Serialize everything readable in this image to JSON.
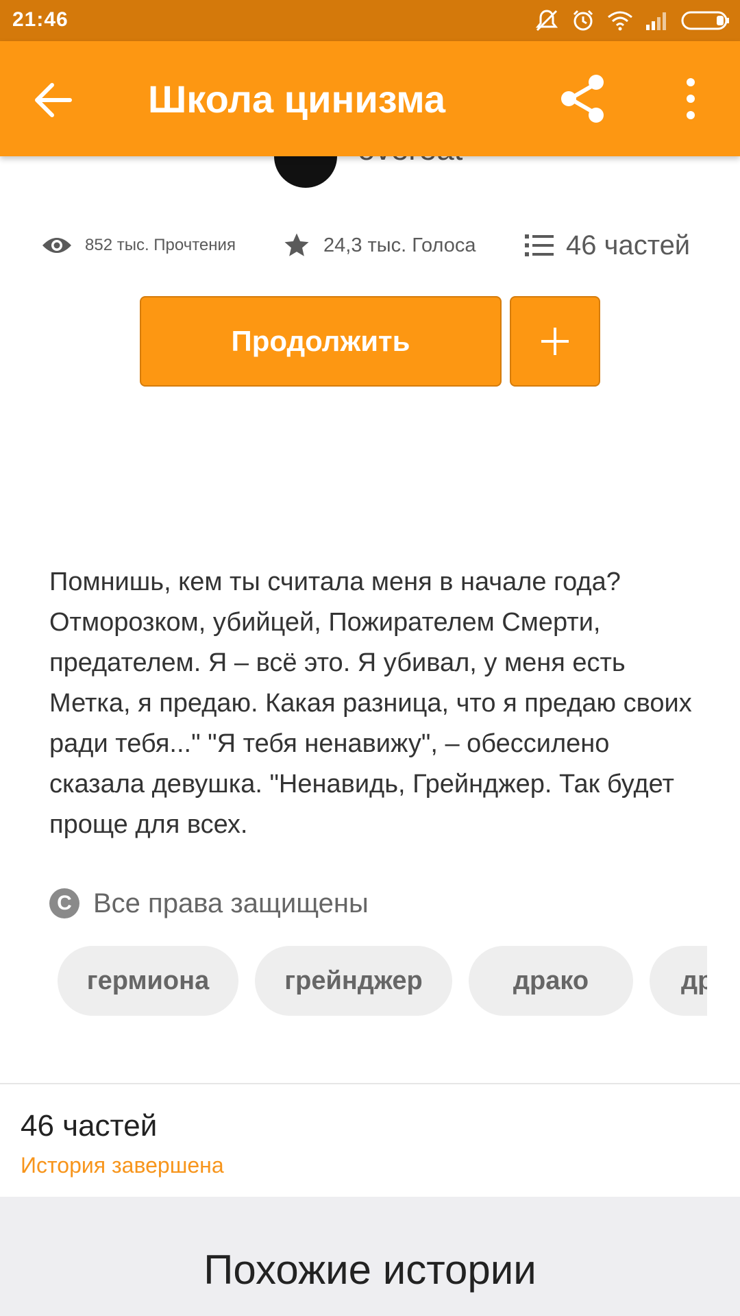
{
  "status_bar": {
    "time": "21:46",
    "icons": [
      "mute-icon",
      "alarm-icon",
      "wifi-icon",
      "signal-icon",
      "battery-icon"
    ]
  },
  "app_bar": {
    "title": "Школа цинизма",
    "back_icon": "arrow-left-icon",
    "share_icon": "share-icon",
    "more_icon": "more-vertical-icon",
    "color": "#fd9712"
  },
  "author": {
    "name": "overeat"
  },
  "stats": {
    "reads": "852 тыс. Прочтения",
    "votes": "24,3 тыс. Голоса",
    "parts": "46 частей"
  },
  "actions": {
    "continue_label": "Продолжить",
    "add_icon": "plus-icon"
  },
  "description": "Помнишь, кем ты считала меня в начале года? Отморозком, убийцей, Пожирателем Смерти, предателем. Я – всё это. Я убивал, у меня есть Метка, я предаю. Какая разница, что я предаю своих ради тебя...\" \"Я тебя ненавижу\", – обессилено сказала девушка. \"Ненавидь, Грейнджер. Так будет проще для всех.",
  "copyright": {
    "icon_letter": "C",
    "text": "Все права защищены"
  },
  "tags": [
    "гермиона",
    "грейнджер",
    "драко",
    "др"
  ],
  "parts_section": {
    "count": "46 частей",
    "status": "История завершена",
    "status_color": "#f7951c"
  },
  "similar": {
    "title": "Похожие истории"
  }
}
